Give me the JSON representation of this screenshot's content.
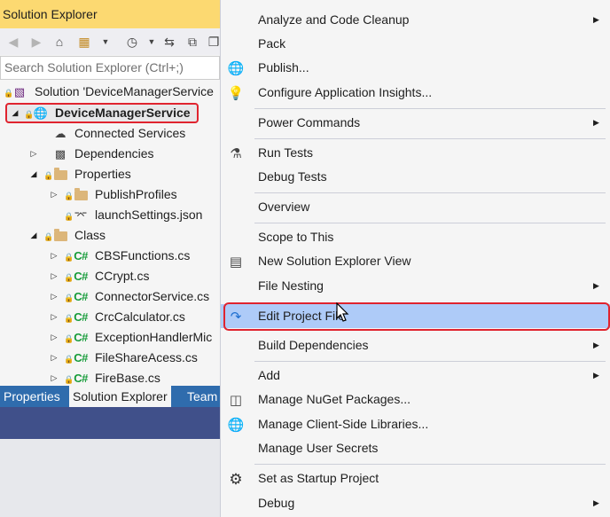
{
  "solution_explorer": {
    "title": "Solution Explorer",
    "search_placeholder": "Search Solution Explorer (Ctrl+;)",
    "tree": [
      {
        "label": "Solution 'DeviceManagerService",
        "icon": "solution-icon",
        "expanded": true
      },
      {
        "label": "DeviceManagerService",
        "icon": "web-project-icon",
        "expanded": true,
        "selected": true
      },
      {
        "label": "Connected Services",
        "icon": "cloud-icon"
      },
      {
        "label": "Dependencies",
        "icon": "dependencies-icon",
        "expanded": false
      },
      {
        "label": "Properties",
        "icon": "properties-folder-icon",
        "expanded": true
      },
      {
        "label": "PublishProfiles",
        "icon": "folder-icon",
        "expanded": false
      },
      {
        "label": "launchSettings.json",
        "icon": "json-file-icon"
      },
      {
        "label": "Class",
        "icon": "folder-icon",
        "expanded": true
      },
      {
        "label": "CBSFunctions.cs",
        "icon": "csharp-file-icon",
        "expanded": false
      },
      {
        "label": "CCrypt.cs",
        "icon": "csharp-file-icon",
        "expanded": false
      },
      {
        "label": "ConnectorService.cs",
        "icon": "csharp-file-icon",
        "expanded": false
      },
      {
        "label": "CrcCalculator.cs",
        "icon": "csharp-file-icon",
        "expanded": false
      },
      {
        "label": "ExceptionHandlerMic",
        "icon": "csharp-file-icon",
        "expanded": false
      },
      {
        "label": "FileShareAcess.cs",
        "icon": "csharp-file-icon",
        "expanded": false
      },
      {
        "label": "FireBase.cs",
        "icon": "csharp-file-icon",
        "expanded": false
      }
    ],
    "tabs": [
      "Properties",
      "Solution Explorer",
      "Team"
    ],
    "csharp_badge": "C#"
  },
  "context_menu": {
    "items": [
      {
        "label": "Analyze and Code Cleanup",
        "submenu": true
      },
      {
        "label": "Pack"
      },
      {
        "label": "Publish...",
        "icon": "globe-publish-icon"
      },
      {
        "label": "Configure Application Insights...",
        "icon": "app-insights-icon"
      },
      {
        "label": "Power Commands",
        "submenu": true
      },
      {
        "label": "Run Tests",
        "icon": "run-tests-icon"
      },
      {
        "label": "Debug Tests"
      },
      {
        "label": "Overview"
      },
      {
        "label": "Scope to This"
      },
      {
        "label": "New Solution Explorer View",
        "icon": "new-view-icon"
      },
      {
        "label": "File Nesting",
        "submenu": true
      },
      {
        "label": "Edit Project File",
        "icon": "edit-project-icon",
        "highlighted": true
      },
      {
        "label": "Build Dependencies",
        "submenu": true
      },
      {
        "label": "Add",
        "submenu": true
      },
      {
        "label": "Manage NuGet Packages...",
        "icon": "nuget-icon"
      },
      {
        "label": "Manage Client-Side Libraries...",
        "icon": "client-libraries-icon"
      },
      {
        "label": "Manage User Secrets"
      },
      {
        "label": "Set as Startup Project",
        "icon": "gear-icon"
      },
      {
        "label": "Debug",
        "submenu": true
      }
    ]
  },
  "colors": {
    "title_bar": "#fcd971",
    "highlight": "#aecbf8",
    "callout": "#e0242f",
    "tab_strip": "#2f6cad"
  }
}
